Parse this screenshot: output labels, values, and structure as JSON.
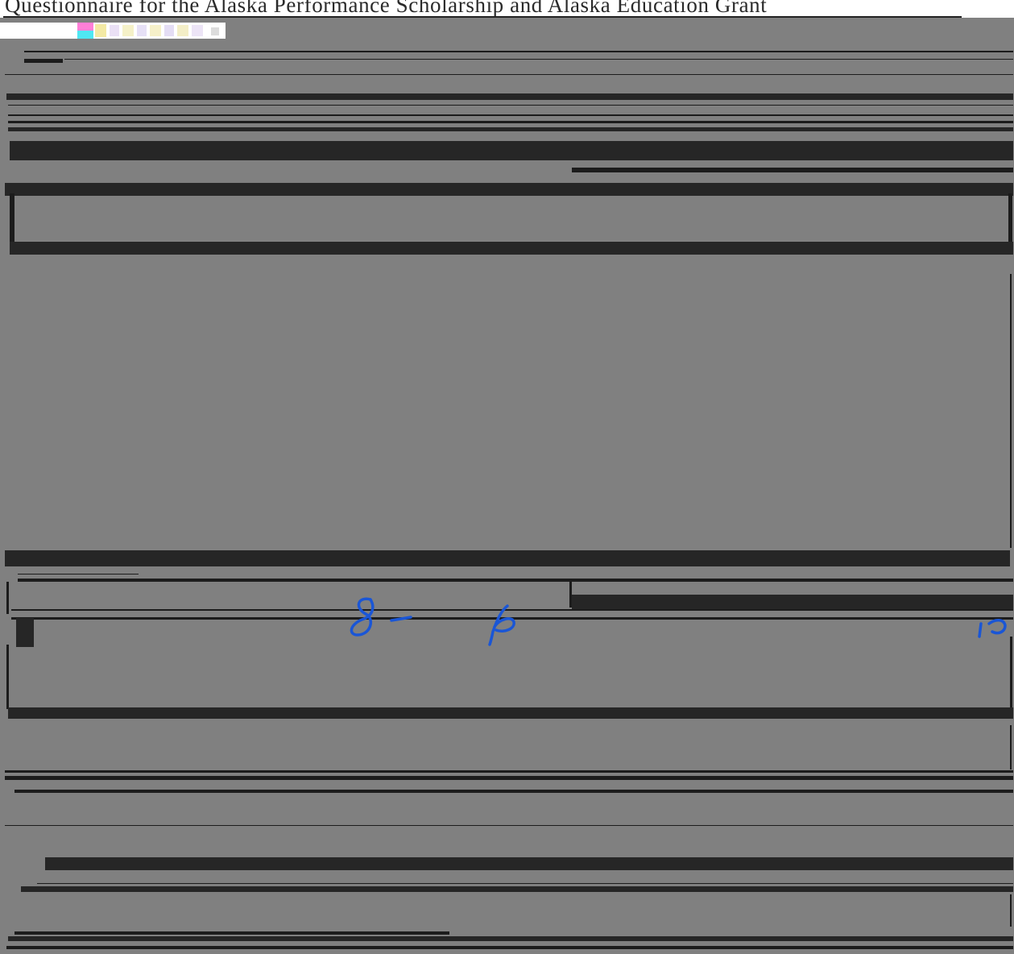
{
  "document": {
    "header_title": "Questionnaire for the Alaska Performance Scholarship and Alaska Education Grant"
  },
  "handwriting": {
    "entry_1": "8-",
    "entry_2": "6",
    "entry_3": "10"
  },
  "colors": {
    "background": "#808080",
    "bar": "#262626",
    "ink": "#1a56d6"
  }
}
